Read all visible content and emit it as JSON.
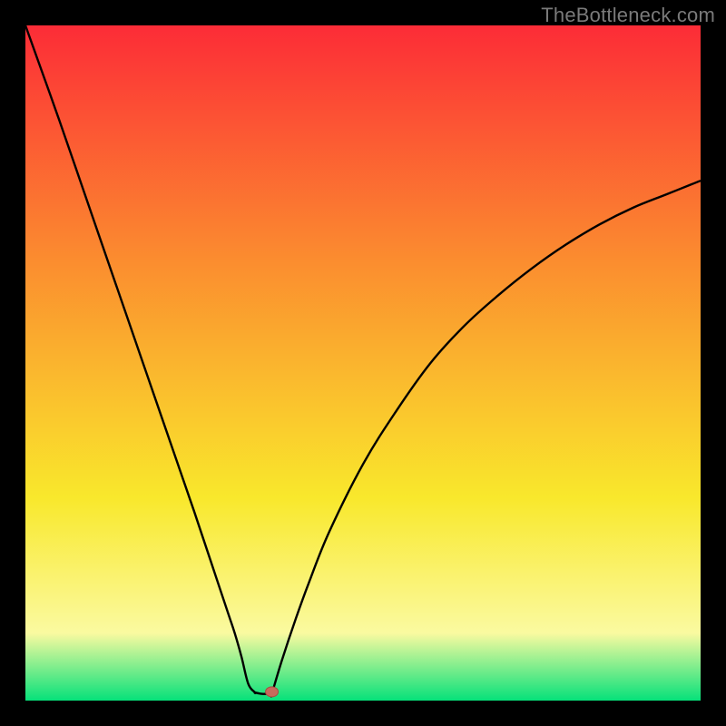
{
  "watermark": "TheBottleneck.com",
  "colors": {
    "page_bg": "#000000",
    "gradient_top": "#fc2c37",
    "gradient_mid1": "#fb8d2f",
    "gradient_mid2": "#f9e82c",
    "gradient_mid3": "#fafaa0",
    "gradient_bottom": "#06e17a",
    "curve": "#000000",
    "marker_fill": "#c76a5c",
    "marker_stroke": "#a84e42"
  },
  "chart_data": {
    "type": "line",
    "title": "",
    "xlabel": "",
    "ylabel": "",
    "xlim": [
      0,
      100
    ],
    "ylim": [
      0,
      100
    ],
    "series": [
      {
        "name": "bottleneck-curve-left",
        "x": [
          0,
          5,
          10,
          15,
          20,
          25,
          28,
          30,
          31,
          32,
          33,
          34
        ],
        "y": [
          100,
          86,
          71.5,
          57,
          42.5,
          28,
          19,
          13,
          10,
          6.5,
          2.5,
          1.2
        ]
      },
      {
        "name": "bottleneck-curve-flat",
        "x": [
          34,
          35,
          36,
          36.5
        ],
        "y": [
          1.2,
          1.0,
          1.0,
          1.0
        ]
      },
      {
        "name": "bottleneck-curve-right",
        "x": [
          36.5,
          38,
          40,
          42,
          45,
          50,
          55,
          60,
          65,
          70,
          75,
          80,
          85,
          90,
          95,
          100
        ],
        "y": [
          1.0,
          6,
          12,
          17.5,
          25,
          35,
          43,
          50,
          55.5,
          60,
          64,
          67.5,
          70.5,
          73,
          75,
          77
        ]
      }
    ],
    "marker": {
      "x": 36.5,
      "y": 1.3
    }
  }
}
